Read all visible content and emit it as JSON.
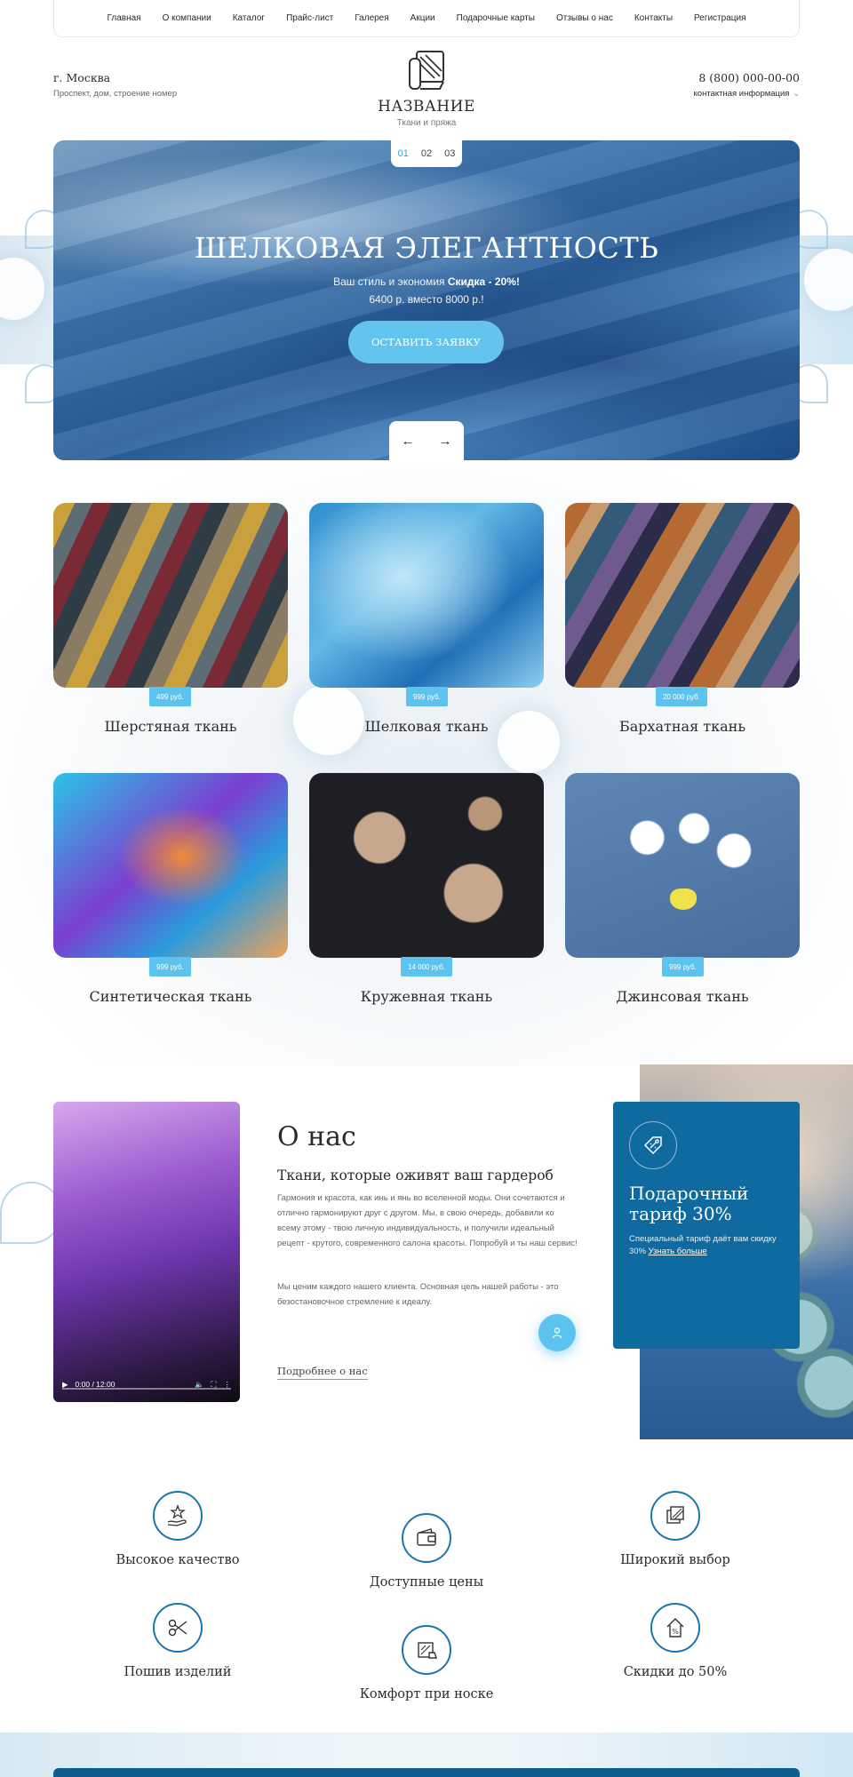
{
  "nav": {
    "items": [
      "Главная",
      "О компании",
      "Каталог",
      "Прайс-лист",
      "Галерея",
      "Акции",
      "Подарочные карты",
      "Отзывы о нас",
      "Контакты",
      "Регистрация"
    ]
  },
  "header": {
    "city": "г. Москва",
    "address": "Проспект, дом, строение номер",
    "brand": "НАЗВАНИЕ",
    "tagline": "Ткани и пряжа",
    "phone": "8 (800) 000-00-00",
    "contact_label": "контактная информация"
  },
  "hero": {
    "slides": [
      "01",
      "02",
      "03"
    ],
    "active_slide": "01",
    "title": "ШЕЛКОВАЯ ЭЛЕГАНТНОСТЬ",
    "subtitle_prefix": "Ваш стиль и экономия",
    "subtitle_bold": "Скидка - 20%!",
    "price_line": "6400 р. вместо 8000 р.!",
    "button": "ОСТАВИТЬ ЗАЯВКУ",
    "prev": "←",
    "next": "→"
  },
  "catalog": [
    {
      "title": "Шерстяная ткань",
      "price": "499 руб."
    },
    {
      "title": "Шелковая ткань",
      "price": "999 руб."
    },
    {
      "title": "Бархатная ткань",
      "price": "20 000 руб."
    },
    {
      "title": "Синтетическая ткань",
      "price": "999 руб."
    },
    {
      "title": "Кружевная ткань",
      "price": "14 000 руб."
    },
    {
      "title": "Джинсовая ткань",
      "price": "999 руб."
    }
  ],
  "about": {
    "heading": "О нас",
    "subheading": "Ткани, которые оживят ваш гардероб",
    "paragraph1": "Гармония и красота, как инь и янь во вселенной моды. Они сочетаются и отлично гармонируют друг с другом. Мы, в свою очередь, добавили ко всему этому - твою личную индивидуальность, и получили идеальный рецепт - крутого, современного салона красоты. Попробуй и ты наш сервис!",
    "paragraph2": "Мы ценим каждого нашего клиента. Основная цель нашей работы - это безостановочное стремление к идеалу.",
    "more_link": "Подробнее о нас",
    "video_time": "0:00 / 12:00"
  },
  "gift": {
    "title": "Подарочный тариф 30%",
    "text": "Специальный тариф даёт вам скидку 30%",
    "link": "Узнать больше"
  },
  "features": [
    {
      "label": "Высокое качество",
      "icon": "quality-hand-star-icon"
    },
    {
      "label": "Доступные цены",
      "icon": "wallet-icon"
    },
    {
      "label": "Широкий выбор",
      "icon": "fabric-swatches-icon"
    },
    {
      "label": "Пошив изделий",
      "icon": "scissors-icon"
    },
    {
      "label": "Комфорт при носке",
      "icon": "iron-icon"
    },
    {
      "label": "Скидки  до 50%",
      "icon": "percent-house-icon"
    }
  ],
  "colors": {
    "accent": "#5cc2ee",
    "brand_blue": "#0f6aa0",
    "text": "#2b2b2b"
  }
}
